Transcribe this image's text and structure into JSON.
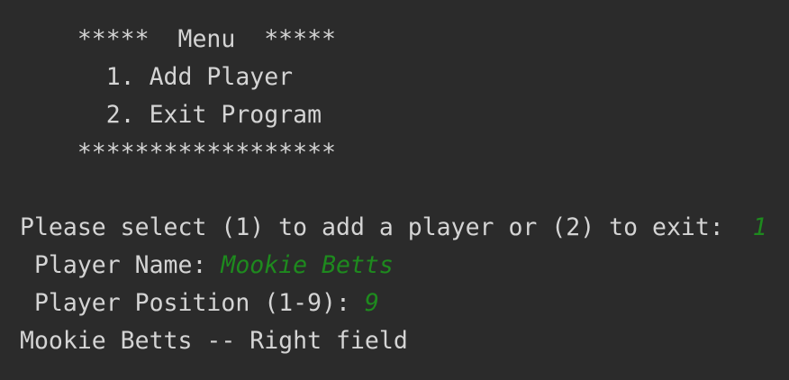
{
  "colors": {
    "background": "#2b2b2b",
    "output_text": "#d4d4d4",
    "user_input": "#1e8a1e"
  },
  "console": {
    "menu_header": "    *****  Menu  *****",
    "menu_item_1": "      1. Add Player",
    "menu_item_2": "      2. Exit Program",
    "menu_footer": "    ******************",
    "select_prompt": "Please select (1) to add a player or (2) to exit:  ",
    "select_input": "1",
    "name_prompt": " Player Name: ",
    "name_input": "Mookie Betts",
    "position_prompt": " Player Position (1-9): ",
    "position_input": "9",
    "result_line": "Mookie Betts -- Right field"
  }
}
